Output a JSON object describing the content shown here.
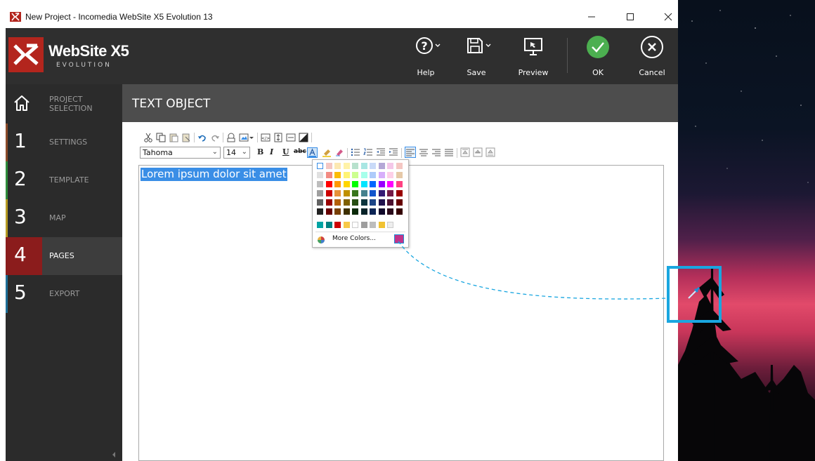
{
  "window": {
    "title": "New Project - Incomedia WebSite X5 Evolution 13"
  },
  "header": {
    "brand": "WebSite X5",
    "brand_sub": "EVOLUTION",
    "buttons": {
      "help": "Help",
      "save": "Save",
      "preview": "Preview",
      "ok": "OK",
      "cancel": "Cancel"
    },
    "ok_color": "#4caf50"
  },
  "sidebar": {
    "items": [
      {
        "num": "",
        "label_1": "PROJECT",
        "label_2": "SELECTION",
        "icon": "home-icon"
      },
      {
        "num": "1",
        "label": "SETTINGS",
        "color": "#8a4b2a"
      },
      {
        "num": "2",
        "label": "TEMPLATE",
        "color": "#2e8b3a"
      },
      {
        "num": "3",
        "label": "MAP",
        "color": "#b59a22"
      },
      {
        "num": "4",
        "label": "PAGES",
        "color": "#8b1c1c"
      },
      {
        "num": "5",
        "label": "EXPORT",
        "color": "#1e6e96"
      }
    ]
  },
  "panel": {
    "title": "TEXT OBJECT"
  },
  "editor": {
    "font_family": "Tahoma",
    "font_size": "14",
    "text": "Lorem ipsum dolor sit amet",
    "bold_label": "B",
    "italic_label": "I",
    "underline_label": "U",
    "strike_label": "abc"
  },
  "palette": {
    "more_colors": "More Colors...",
    "selected_color": "#c1348a"
  },
  "annotation": {
    "accent": "#19a6e0"
  }
}
